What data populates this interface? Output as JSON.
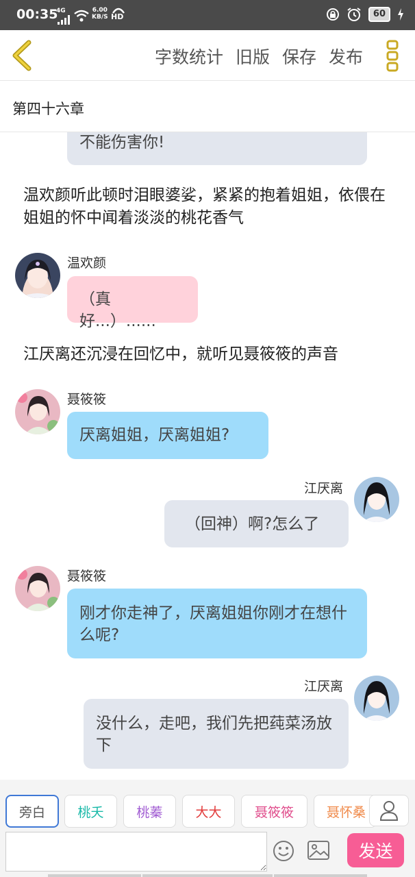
{
  "status_bar": {
    "time": "00:35",
    "network": "4G",
    "speed_value": "6.00",
    "speed_unit": "KB/S",
    "hd": "HD",
    "battery": "60"
  },
  "toolbar": {
    "word_count": "字数统计",
    "old_version": "旧版",
    "save": "保存",
    "publish": "发布"
  },
  "chapter": {
    "title": "第四十六章"
  },
  "messages": [
    {
      "text": "不能伤害你!"
    },
    {
      "text": "温欢颜听此顿时泪眼婆娑，紧紧的抱着姐姐，依偎在姐姐的怀中闻着淡淡的桃花香气"
    },
    {
      "name": "温欢颜",
      "text": "（真好...）......"
    },
    {
      "text": "江厌离还沉浸在回忆中，就听见聂筱筱的声音"
    },
    {
      "name": "聂筱筱",
      "text": "厌离姐姐，厌离姐姐?"
    },
    {
      "name": "江厌离",
      "text": "（回神）啊?怎么了"
    },
    {
      "name": "聂筱筱",
      "text": "刚才你走神了，厌离姐姐你刚才在想什么呢?"
    },
    {
      "name": "江厌离",
      "text": "没什么，走吧，我们先把莼菜汤放下"
    }
  ],
  "roles": [
    {
      "label": "旁白",
      "color": "#555555"
    },
    {
      "label": "桃夭",
      "color": "#19b9a8"
    },
    {
      "label": "桃蓁",
      "color": "#a05bd2"
    },
    {
      "label": "大大",
      "color": "#e23b3b"
    },
    {
      "label": "聂筱筱",
      "color": "#e04d8c"
    },
    {
      "label": "聂怀桑",
      "color": "#f08a4a"
    }
  ],
  "input": {
    "placeholder": ""
  },
  "send": {
    "label": "发送"
  },
  "colors": {
    "accent": "#f75d95",
    "bubble_gray": "#e2e6ee",
    "bubble_blue": "#9fdcfb",
    "bubble_pink": "#ffd2db",
    "menu_yellow": "#e7c63a"
  }
}
